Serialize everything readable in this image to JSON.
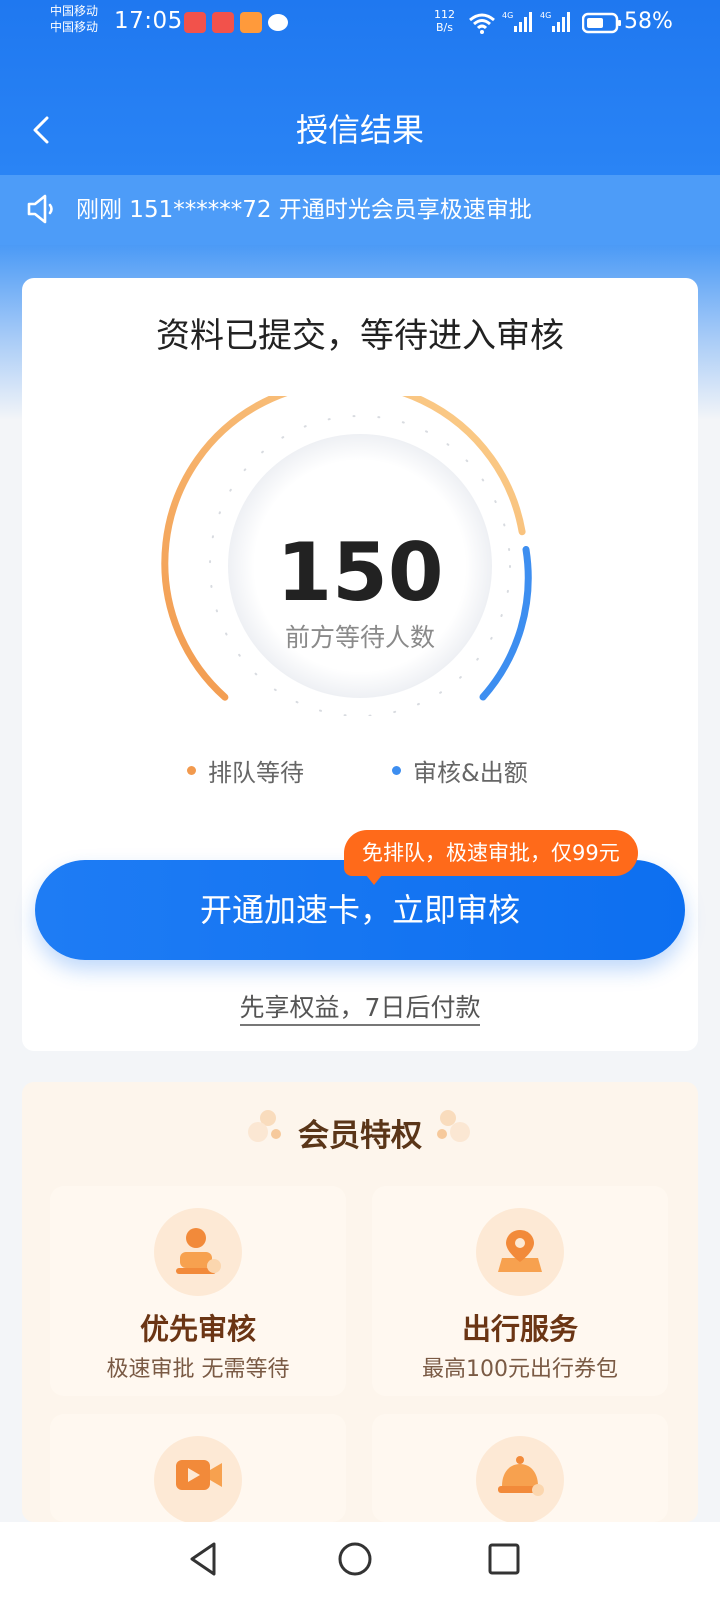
{
  "status_bar": {
    "carrier1": "中国移动",
    "carrier2": "中国移动",
    "time": "17:05",
    "net_speed_value": "112",
    "net_speed_unit": "B/s",
    "battery": "58%"
  },
  "header": {
    "title": "授信结果"
  },
  "notice": {
    "text": "刚刚 151******72 开通时光会员享极速审批"
  },
  "status_card": {
    "title": "资料已提交，等待进入审核",
    "queue_count": "150",
    "queue_label": "前方等待人数",
    "legend_queue": "排队等待",
    "legend_review": "审核&出额",
    "cta_label": "开通加速卡，立即审核",
    "cta_tip": "免排队，极速审批，仅99元",
    "pay_later": "先享权益，7日后付款",
    "colors": {
      "queue": "#f29a4e",
      "review": "#3d8ef0",
      "cta": "#1e7cf4",
      "tip": "#ff6a1a"
    }
  },
  "member": {
    "title": "会员特权",
    "perks": [
      {
        "title": "优先审核",
        "desc": "极速审批 无需等待",
        "icon": "user-stamp-icon"
      },
      {
        "title": "出行服务",
        "desc": "最高100元出行券包",
        "icon": "location-pin-icon"
      },
      {
        "title": "",
        "desc": "",
        "icon": "video-play-icon"
      },
      {
        "title": "",
        "desc": "",
        "icon": "service-bell-icon"
      }
    ]
  }
}
